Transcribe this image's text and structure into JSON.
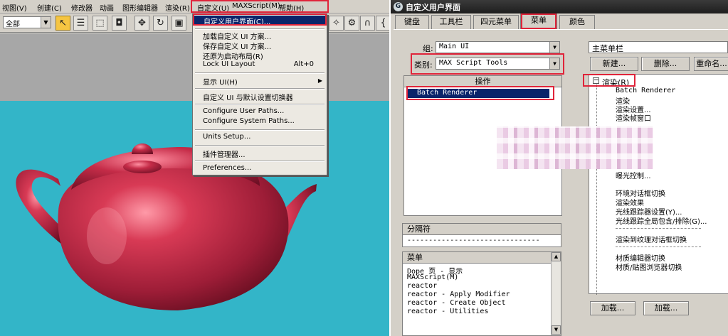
{
  "menubar": {
    "items": [
      "视图(V)",
      "创建(C)",
      "修改器",
      "动画",
      "图形编辑器",
      "渲染(R)",
      "自定义(U)",
      "MAXScript(M)",
      "帮助(H)"
    ]
  },
  "toolbar": {
    "selection_filter": "全部"
  },
  "customize_menu": {
    "items": [
      {
        "label": "自定义用户界面(C)..."
      },
      {
        "label": "加载自定义 UI 方案..."
      },
      {
        "label": "保存自定义 UI 方案..."
      },
      {
        "label": "还原为启动布局(R)"
      },
      {
        "label": "Lock UI Layout",
        "shortcut": "Alt+0"
      },
      {
        "label": "显示 UI(H)"
      },
      {
        "label": "自定义 UI 与默认设置切换器"
      },
      {
        "label": "Configure User Paths..."
      },
      {
        "label": "Configure System Paths..."
      },
      {
        "label": "Units Setup..."
      },
      {
        "label": "插件管理器..."
      },
      {
        "label": "Preferences..."
      }
    ]
  },
  "dialog": {
    "title": "自定义用户界面",
    "tabs": [
      "键盘",
      "工具栏",
      "四元菜单",
      "菜单",
      "颜色"
    ],
    "group_label": "组:",
    "group_value": "Main UI",
    "category_label": "类别:",
    "category_value": "MAX Script Tools",
    "actions_header": "操作",
    "actions": [
      "Batch Renderer"
    ],
    "separator_header": "分隔符",
    "separator_item": "-------------------------------",
    "menus_header": "菜单",
    "menus": [
      "Dope 页 - 显示",
      "MAXScript(M)",
      "reactor",
      "reactor - Apply Modifier",
      "reactor - Create Object",
      "reactor - Utilities"
    ],
    "main_menu_combo": "主菜单栏",
    "buttons": {
      "new": "新建...",
      "delete": "删除...",
      "rename": "重命名...",
      "load": "加载...",
      "load2": "加载..."
    },
    "tree": {
      "root": "渲染(R)",
      "items": [
        "Batch Renderer",
        "渲染",
        "渲染设置...",
        "渲染帧窗口",
        "曝光控制...",
        "环境对话框切换",
        "渲染效果",
        "光线跟踪器设置(Y)...",
        "光线跟踪全局包含/排除(G)...",
        "渲染到纹理对话框切换",
        "材质编辑器切换",
        "材质/贴图浏览器切换"
      ]
    }
  },
  "colors": {
    "viewport_floor": "#33b5c8",
    "viewport_sky": "#a9a9a9",
    "teapot": "#b3213f",
    "highlight": "#0a246a",
    "annotation_red": "#e0243a"
  }
}
